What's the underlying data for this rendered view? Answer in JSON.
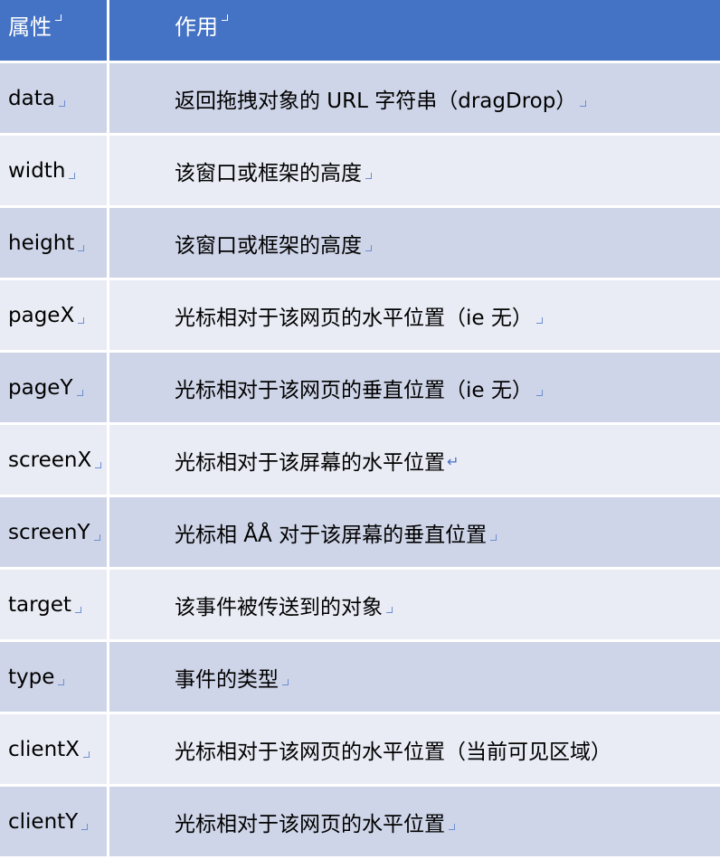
{
  "header": {
    "attr_label": "属性",
    "effect_label": "作用"
  },
  "rows": [
    {
      "name": "data",
      "desc": "返回拖拽对象的 URL 字符串（dragDrop）"
    },
    {
      "name": "width",
      "desc": "该窗口或框架的高度"
    },
    {
      "name": "height",
      "desc": "该窗口或框架的高度"
    },
    {
      "name": "pageX",
      "desc": "光标相对于该网页的水平位置（ie 无）"
    },
    {
      "name": "pageY",
      "desc": "光标相对于该网页的垂直位置（ie 无）"
    },
    {
      "name": "screenX",
      "desc": "光标相对于该屏幕的水平位置"
    },
    {
      "name": "screenY",
      "desc": "光标相 ÅÅ 对于该屏幕的垂直位置"
    },
    {
      "name": "target",
      "desc": "该事件被传送到的对象"
    },
    {
      "name": "type",
      "desc": "事件的类型"
    },
    {
      "name": "clientX",
      "desc": "光标相对于该网页的水平位置（当前可见区域）"
    },
    {
      "name": "clientY",
      "desc": "光标相对于该网页的水平位置"
    }
  ],
  "colors": {
    "header_bg": "#4472c4",
    "row_dark": "#cfd5e8",
    "row_light": "#e9ecf4"
  }
}
